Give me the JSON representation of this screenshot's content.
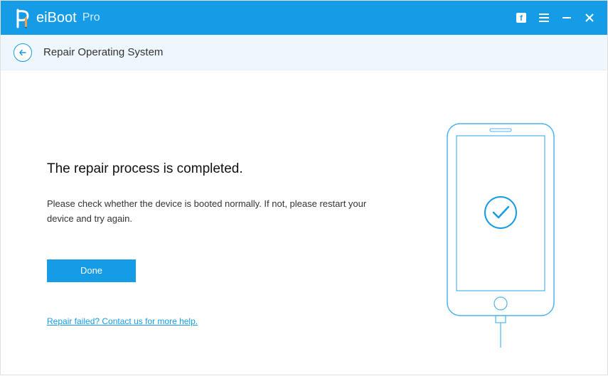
{
  "titlebar": {
    "brand": "eiBoot",
    "pro_label": "Pro",
    "icons": {
      "facebook": "facebook-icon",
      "menu": "menu-icon",
      "minimize": "minimize-icon",
      "close": "close-icon"
    }
  },
  "subheader": {
    "title": "Repair Operating System"
  },
  "main": {
    "headline": "The repair process is completed.",
    "subtext": "Please check whether the device is booted normally. If not, please restart your device and try again.",
    "done_label": "Done",
    "help_link": "Repair failed? Contact us for more help."
  },
  "colors": {
    "brand": "#169be6"
  }
}
